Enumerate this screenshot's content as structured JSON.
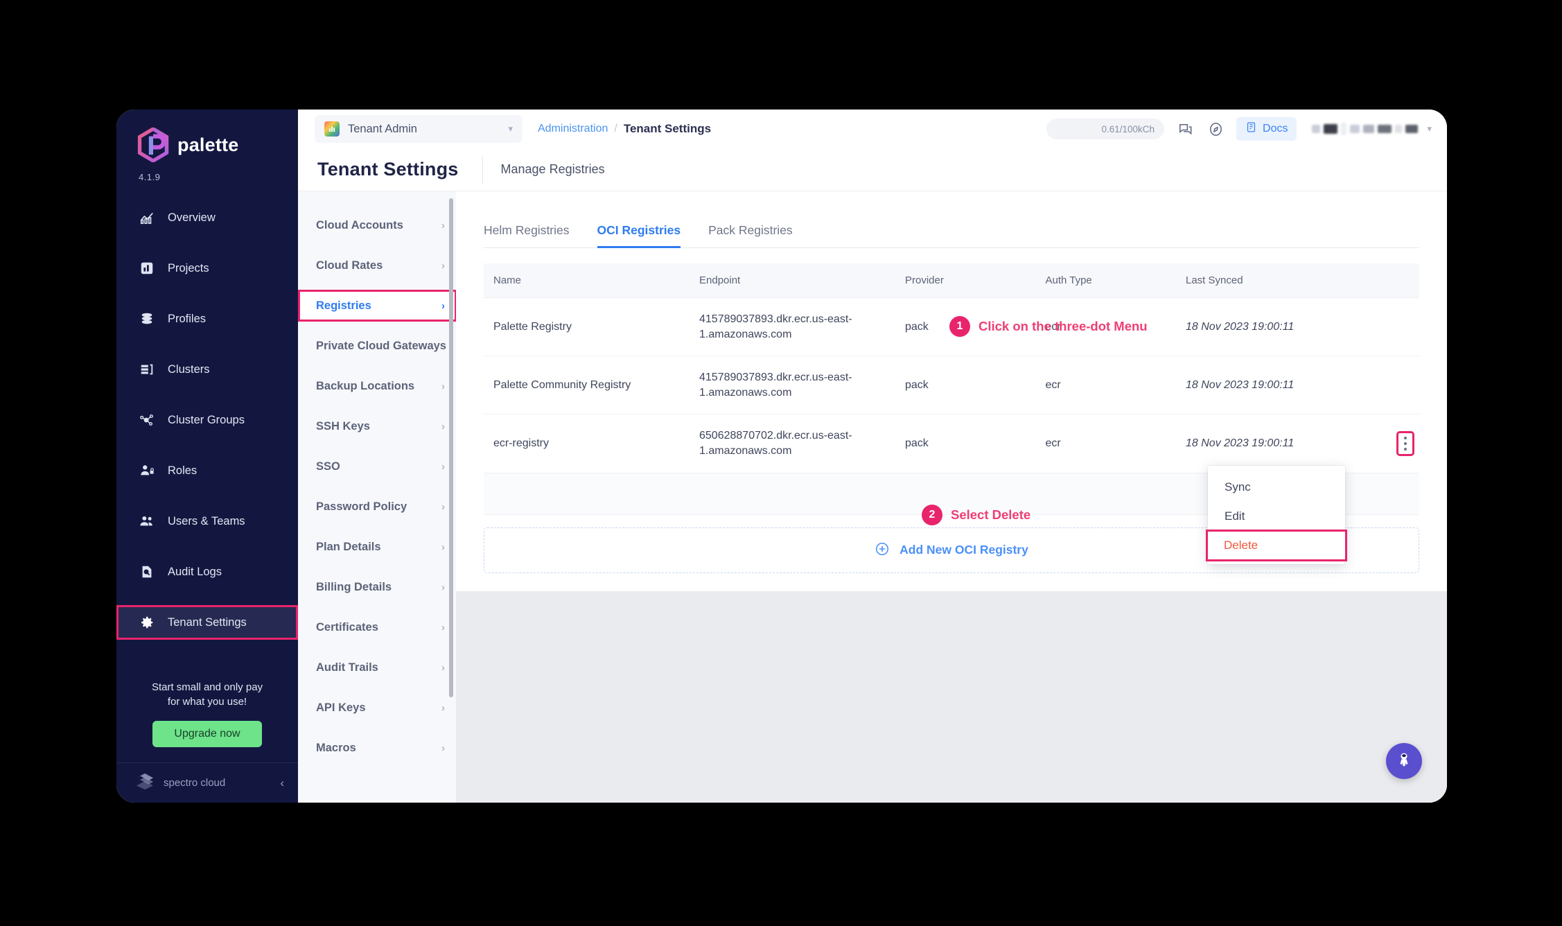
{
  "brand": {
    "name": "palette",
    "version": "4.1.9"
  },
  "sidebar": {
    "items": [
      {
        "label": "Overview",
        "icon": "chart-overview-icon"
      },
      {
        "label": "Projects",
        "icon": "projects-icon"
      },
      {
        "label": "Profiles",
        "icon": "profiles-stack-icon"
      },
      {
        "label": "Clusters",
        "icon": "clusters-icon"
      },
      {
        "label": "Cluster Groups",
        "icon": "cluster-groups-icon"
      },
      {
        "label": "Roles",
        "icon": "roles-user-lock-icon"
      },
      {
        "label": "Users & Teams",
        "icon": "users-teams-icon"
      },
      {
        "label": "Audit Logs",
        "icon": "audit-logs-icon"
      },
      {
        "label": "Tenant Settings",
        "icon": "gear-icon",
        "active": true
      }
    ],
    "promo_line1": "Start small and only pay",
    "promo_line2": "for what you use!",
    "upgrade_label": "Upgrade now",
    "footer_label": "spectro cloud"
  },
  "topbar": {
    "tenant_name": "Tenant Admin",
    "breadcrumb_link": "Administration",
    "breadcrumb_sep": "/",
    "breadcrumb_current": "Tenant Settings",
    "usage": "0.61/100kCh",
    "docs_label": "Docs"
  },
  "page": {
    "title": "Tenant Settings",
    "subtitle": "Manage Registries"
  },
  "settings_nav": {
    "items": [
      {
        "label": "Cloud Accounts"
      },
      {
        "label": "Cloud Rates"
      },
      {
        "label": "Registries",
        "active": true
      },
      {
        "label": "Private Cloud Gateways"
      },
      {
        "label": "Backup Locations"
      },
      {
        "label": "SSH Keys"
      },
      {
        "label": "SSO"
      },
      {
        "label": "Password Policy"
      },
      {
        "label": "Plan Details"
      },
      {
        "label": "Billing Details"
      },
      {
        "label": "Certificates"
      },
      {
        "label": "Audit Trails"
      },
      {
        "label": "API Keys"
      },
      {
        "label": "Macros"
      }
    ]
  },
  "tabs": [
    {
      "label": "Helm Registries",
      "active": false
    },
    {
      "label": "OCI Registries",
      "active": true
    },
    {
      "label": "Pack Registries",
      "active": false
    }
  ],
  "table": {
    "columns": [
      "Name",
      "Endpoint",
      "Provider",
      "Auth Type",
      "Last Synced"
    ],
    "rows": [
      {
        "name": "Palette Registry",
        "endpoint": "415789037893.dkr.ecr.us-east-1.amazonaws.com",
        "provider": "pack",
        "auth_type": "ecr",
        "last_synced": "18 Nov 2023 19:00:11",
        "has_menu": false
      },
      {
        "name": "Palette Community Registry",
        "endpoint": "415789037893.dkr.ecr.us-east-1.amazonaws.com",
        "provider": "pack",
        "auth_type": "ecr",
        "last_synced": "18 Nov 2023 19:00:11",
        "has_menu": false
      },
      {
        "name": "ecr-registry",
        "endpoint": "650628870702.dkr.ecr.us-east-1.amazonaws.com",
        "provider": "pack",
        "auth_type": "ecr",
        "last_synced": "18 Nov 2023 19:00:11",
        "has_menu": true
      }
    ]
  },
  "add_registry": {
    "label": "Add New OCI Registry",
    "icon": "plus-circle-icon"
  },
  "dropdown": {
    "items": [
      {
        "label": "Sync",
        "danger": false
      },
      {
        "label": "Edit",
        "danger": false
      },
      {
        "label": "Delete",
        "danger": true,
        "highlighted": true
      }
    ]
  },
  "annotations": [
    {
      "number": "1",
      "text": "Click on the three-dot Menu"
    },
    {
      "number": "2",
      "text": "Select Delete"
    }
  ],
  "colors": {
    "accent_pink": "#e8246c",
    "link_blue": "#2f7cf0",
    "sidebar_bg": "#131740",
    "upgrade_green": "#6ee38a",
    "delete_red": "#f0593c",
    "fab_purple": "#5a4fcf"
  },
  "fab": {
    "icon": "astronaut-icon"
  }
}
